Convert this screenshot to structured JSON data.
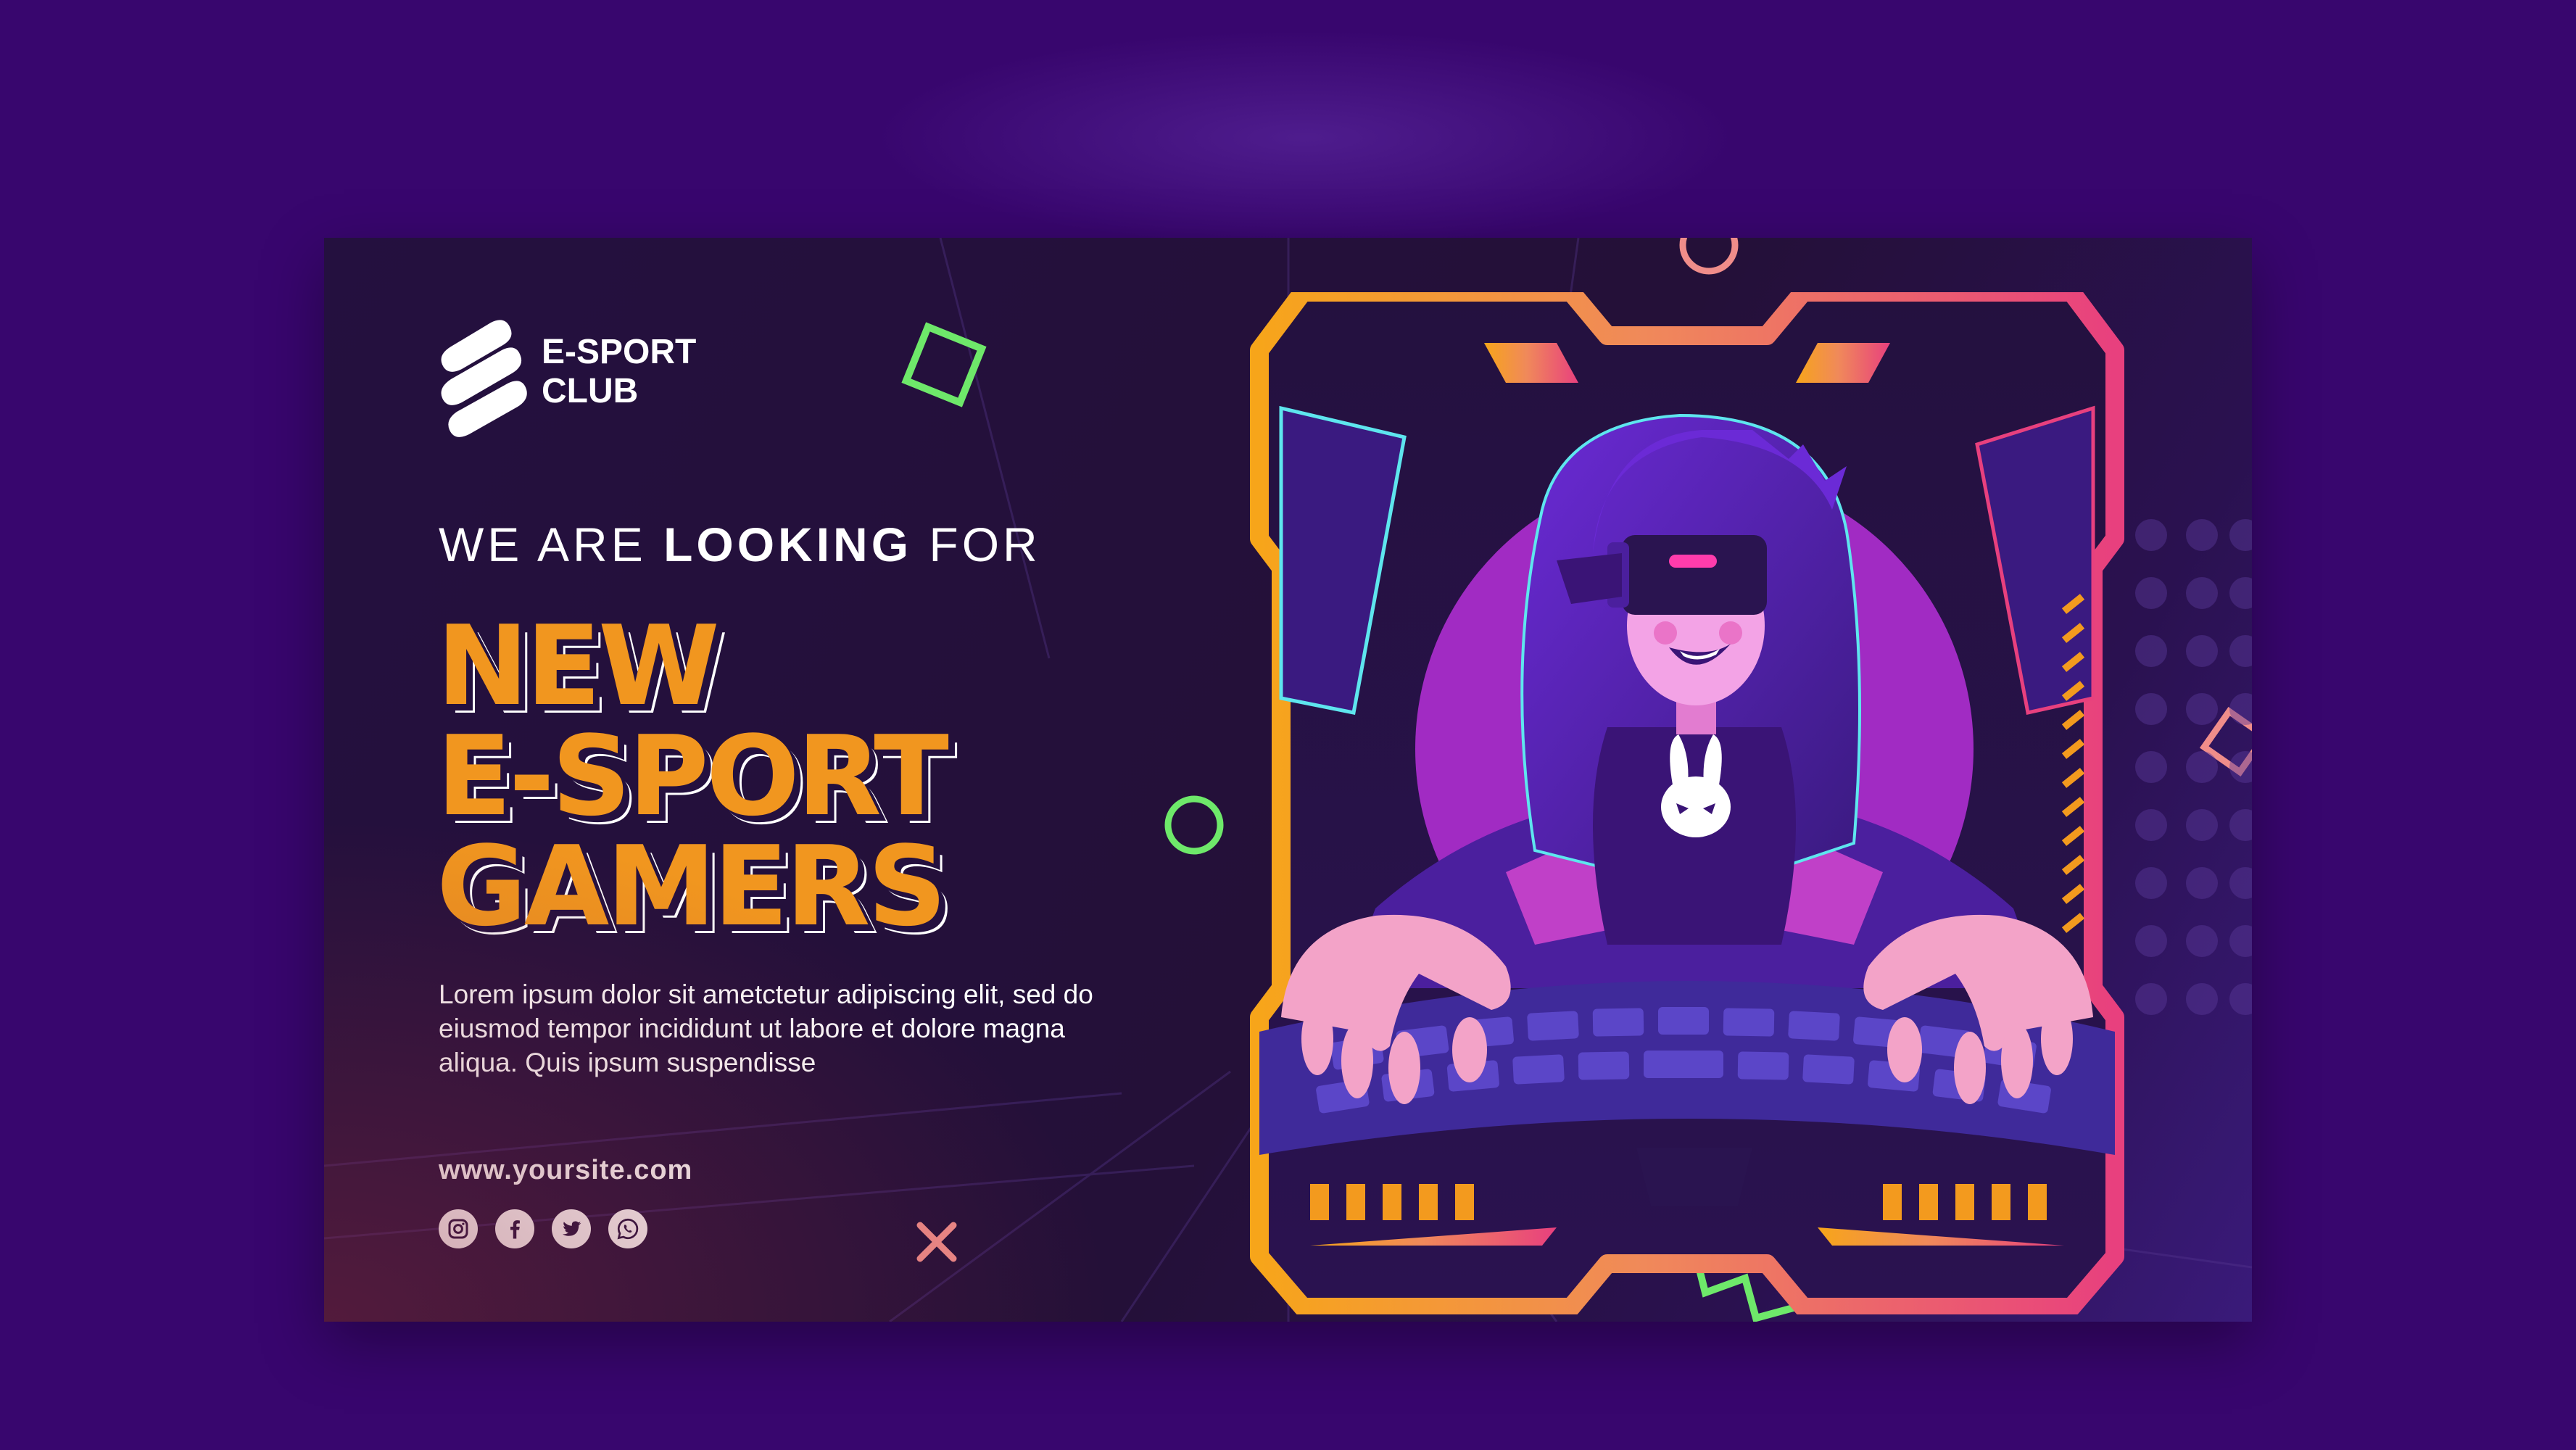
{
  "logo": {
    "text": "E-SPORT\nCLUB"
  },
  "tagline": {
    "prefix": "WE ARE ",
    "bold": "LOOKING",
    "suffix": " FOR"
  },
  "headline": {
    "line1": "NEW",
    "line2": "E-SPORT",
    "line3": "GAMERS"
  },
  "body": "Lorem ipsum dolor sit ametctetur adipiscing elit, sed do eiusmod tempor incididunt ut labore et dolore magna aliqua. Quis ipsum suspendisse",
  "site_url": "www.yoursite.com",
  "socials": [
    "instagram-icon",
    "facebook-icon",
    "twitter-icon",
    "whatsapp-icon"
  ],
  "colors": {
    "outer_bg": "#38066e",
    "banner_bg": "#24103f",
    "headline": "#f1961f",
    "accent_green": "#6ee86a",
    "accent_pink": "#f08d8a",
    "frame_orange": "#f39a1e",
    "frame_pink": "#e8407e",
    "purple_glow": "#a12bc3"
  }
}
